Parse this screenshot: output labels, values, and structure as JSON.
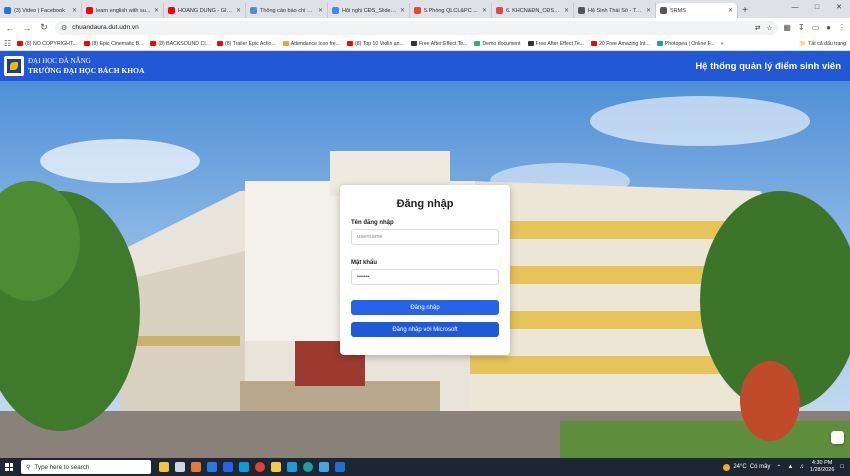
{
  "browser": {
    "tabs": [
      {
        "label": "(3) Video | Facebook",
        "icon": "facebook-icon",
        "color": "#1877f2"
      },
      {
        "label": "learn english with su...",
        "icon": "youtube-icon",
        "color": "#ff0000"
      },
      {
        "label": "HOÀNG DŨNG - GIỮ ...",
        "icon": "youtube-icon",
        "color": "#ff0000"
      },
      {
        "label": "Thông cáo báo chí C...",
        "icon": "document-icon",
        "color": "#4a90d9"
      },
      {
        "label": "Hội nghị CĐS_Slides...",
        "icon": "slides-icon",
        "color": "#4285f4"
      },
      {
        "label": "5.Phòng QLCL&PC ...",
        "icon": "pdf-icon",
        "color": "#e8453c"
      },
      {
        "label": "6. KHCN&ĐN_CĐS N...",
        "icon": "pdf-icon",
        "color": "#e8453c"
      },
      {
        "label": "Hệ Sinh Thái Số - Trư...",
        "icon": "page-icon",
        "color": "#555555"
      },
      {
        "label": "SRMS",
        "icon": "page-icon",
        "color": "#555555",
        "active": true
      }
    ],
    "url": "chuandaura.dut.udn.vn",
    "bookmarks": [
      {
        "label": "(8) NO COPYRIGHT...",
        "color": "#ff0000"
      },
      {
        "label": "(8) Epic Cinematic B...",
        "color": "#ff0000"
      },
      {
        "label": "(8) BACKSOUND CI...",
        "color": "#ff0000"
      },
      {
        "label": "(8) Trailer Epic Actio...",
        "color": "#ff0000"
      },
      {
        "label": "Attendance Icon fre...",
        "color": "#f5a623"
      },
      {
        "label": "(8) Top 10 Violin an...",
        "color": "#ff0000"
      },
      {
        "label": "Free After Effect Te...",
        "color": "#333333"
      },
      {
        "label": "Demo document",
        "color": "#2ab27b"
      },
      {
        "label": "Free After Effect Te...",
        "color": "#333333"
      },
      {
        "label": "20 Free Amazing Int...",
        "color": "#ff0000"
      },
      {
        "label": "Photopea | Online F...",
        "color": "#18a497"
      }
    ],
    "bookmarks_all": "Tất cả dấu trang"
  },
  "header": {
    "university_line1": "ĐẠI HỌC ĐÀ NẴNG",
    "university_line2": "TRƯỜNG ĐẠI HỌC BÁCH KHOA",
    "system_title": "Hệ thống quản lý điểm sinh viên"
  },
  "login": {
    "title": "Đăng nhập",
    "username_label": "Tên đăng nhập",
    "username_placeholder": "username",
    "password_label": "Mật khẩu",
    "password_value": "••••••",
    "login_button": "Đăng nhập",
    "microsoft_button": "Đăng nhập với Microsoft"
  },
  "taskbar": {
    "search_placeholder": "Type here to search",
    "weather_temp": "24°C",
    "weather_desc": "Có mây",
    "time": "4:30 PM",
    "date": "1/28/2026"
  },
  "colors": {
    "header_blue": "#2257d6",
    "button_blue": "#2563eb"
  }
}
